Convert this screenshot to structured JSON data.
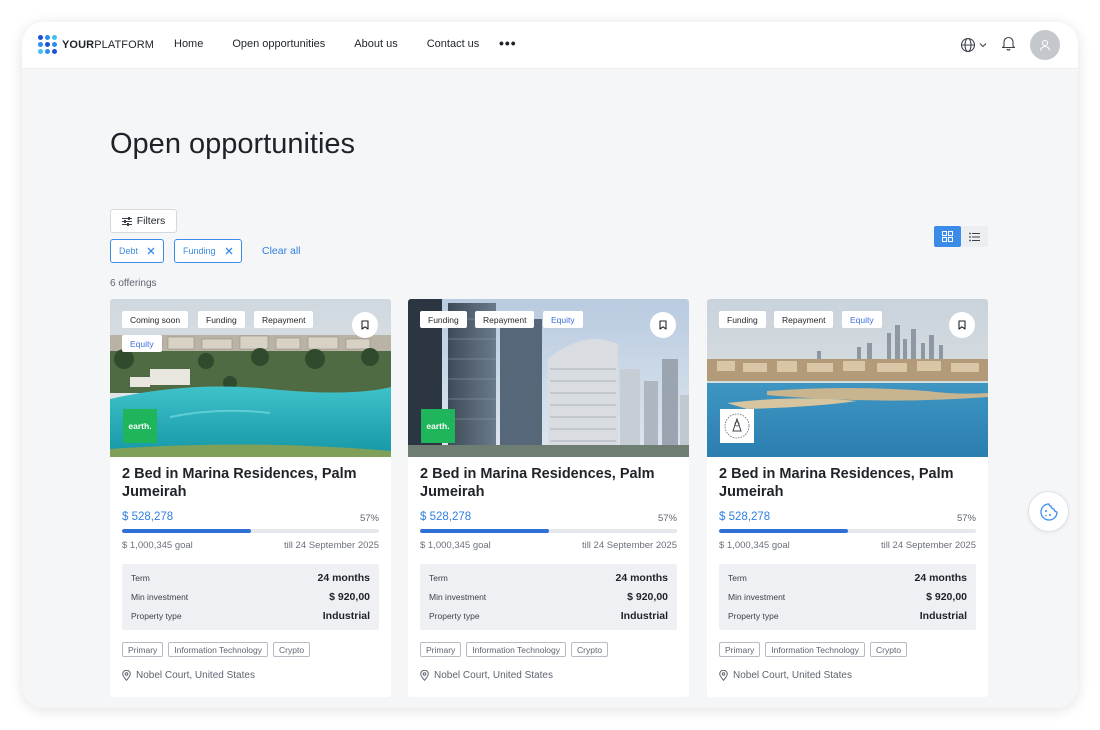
{
  "brand": {
    "strong": "YOUR",
    "light": "PLATFORM"
  },
  "nav": {
    "links": [
      "Home",
      "Open opportunities",
      "About us",
      "Contact us"
    ],
    "more": "•••"
  },
  "page": {
    "title": "Open opportunities",
    "filters_label": "Filters",
    "chips": [
      "Debt",
      "Funding"
    ],
    "clear_all": "Clear all",
    "offering_count": "6 offerings"
  },
  "colors": {
    "accent": "#3b8ce8",
    "progress": "#2f6fd6",
    "brand_logo": "#1fb55a"
  },
  "cards": [
    {
      "tags_row1": [
        "Coming soon",
        "Funding",
        "Repayment"
      ],
      "tags_row2": [
        "Equity"
      ],
      "brand_logo_text": "earth.",
      "title": "2 Bed in Marina Residences, Palm Jumeirah",
      "raised": "$ 528,278",
      "percent": "57%",
      "progress": 0.5,
      "goal": "$ 1,000,345 goal",
      "deadline": "till 24 September 2025",
      "term_label": "Term",
      "term_value": "24 months",
      "min_label": "Min investment",
      "min_value": "$ 920,00",
      "type_label": "Property type",
      "type_value": "Industrial",
      "categories": [
        "Primary",
        "Information Technology",
        "Crypto"
      ],
      "location": "Nobel Court, United States"
    },
    {
      "tags_row1": [
        "Funding",
        "Repayment",
        "Equity"
      ],
      "tags_row2": [],
      "brand_logo_text": "earth.",
      "title": "2 Bed in Marina Residences, Palm Jumeirah",
      "raised": "$ 528,278",
      "percent": "57%",
      "progress": 0.5,
      "goal": "$ 1,000,345 goal",
      "deadline": "till 24 September 2025",
      "term_label": "Term",
      "term_value": "24 months",
      "min_label": "Min investment",
      "min_value": "$ 920,00",
      "type_label": "Property type",
      "type_value": "Industrial",
      "categories": [
        "Primary",
        "Information Technology",
        "Crypto"
      ],
      "location": "Nobel Court, United States"
    },
    {
      "tags_row1": [
        "Funding",
        "Repayment",
        "Equity"
      ],
      "tags_row2": [],
      "brand_logo_text": "",
      "title": "2 Bed in Marina Residences, Palm Jumeirah",
      "raised": "$ 528,278",
      "percent": "57%",
      "progress": 0.5,
      "goal": "$ 1,000,345 goal",
      "deadline": "till 24 September 2025",
      "term_label": "Term",
      "term_value": "24 months",
      "min_label": "Min investment",
      "min_value": "$ 920,00",
      "type_label": "Property type",
      "type_value": "Industrial",
      "categories": [
        "Primary",
        "Information Technology",
        "Crypto"
      ],
      "location": "Nobel Court, United States"
    }
  ]
}
